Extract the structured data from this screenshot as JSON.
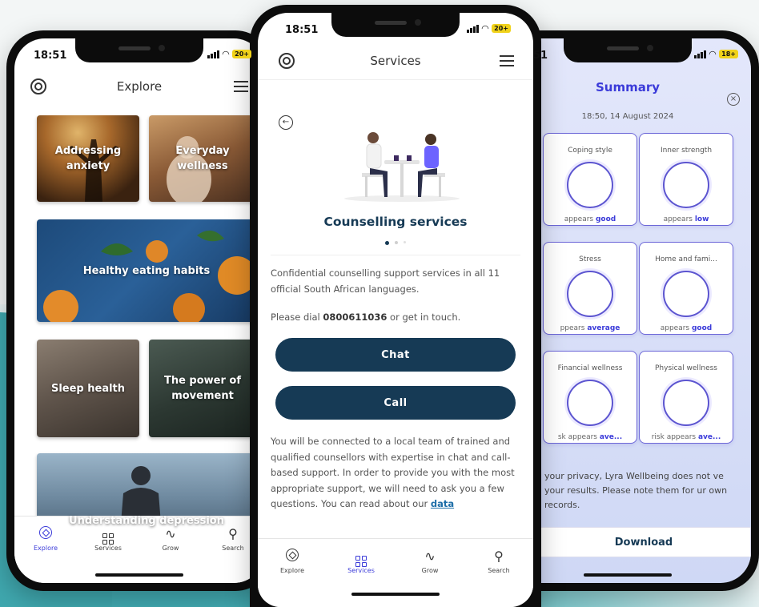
{
  "status": {
    "time": "18:51",
    "battery": "20+",
    "battery_right": "18+"
  },
  "explore": {
    "title": "Explore",
    "tiles": [
      "Addressing anxiety",
      "Everyday wellness",
      "Healthy eating habits",
      "Sleep health",
      "The power of movement",
      "Understanding depression"
    ]
  },
  "services": {
    "title": "Services",
    "heading": "Counselling services",
    "intro": "Confidential counselling support services in all 11 official South African languages.",
    "dial_prefix": "Please dial ",
    "phone": "0800611036",
    "dial_suffix": " or get in touch.",
    "chat_label": "Chat",
    "call_label": "Call",
    "body": "You will be connected to a local team of trained and qualified counsellors with expertise in chat and call-based support. In order to provide you with the most appropriate support, we will need to ask you a few questions. You can read about our ",
    "body_link": "data"
  },
  "nav": [
    "Explore",
    "Services",
    "Grow",
    "Search"
  ],
  "summary": {
    "time": "51",
    "title": "Summary",
    "date": "18:50, 14 August 2024",
    "cards": [
      {
        "title": "Coping style",
        "prefix": "appears ",
        "value": "good"
      },
      {
        "title": "Inner strength",
        "prefix": "appears ",
        "value": "low"
      },
      {
        "title": "Stress",
        "prefix": "ppears ",
        "value": "average"
      },
      {
        "title": "Home and fami...",
        "prefix": "appears ",
        "value": "good"
      },
      {
        "title": "Financial wellness",
        "prefix": "sk appears ",
        "value": "ave..."
      },
      {
        "title": "Physical wellness",
        "prefix": "risk appears ",
        "value": "ave..."
      }
    ],
    "privacy": "your privacy, Lyra Wellbeing does not ve your results. Please note them for ur own records.",
    "download_label": "Download"
  },
  "colors": {
    "primary": "#163a55",
    "accent": "#3b3bd9",
    "teal": "#3fa7ae"
  }
}
